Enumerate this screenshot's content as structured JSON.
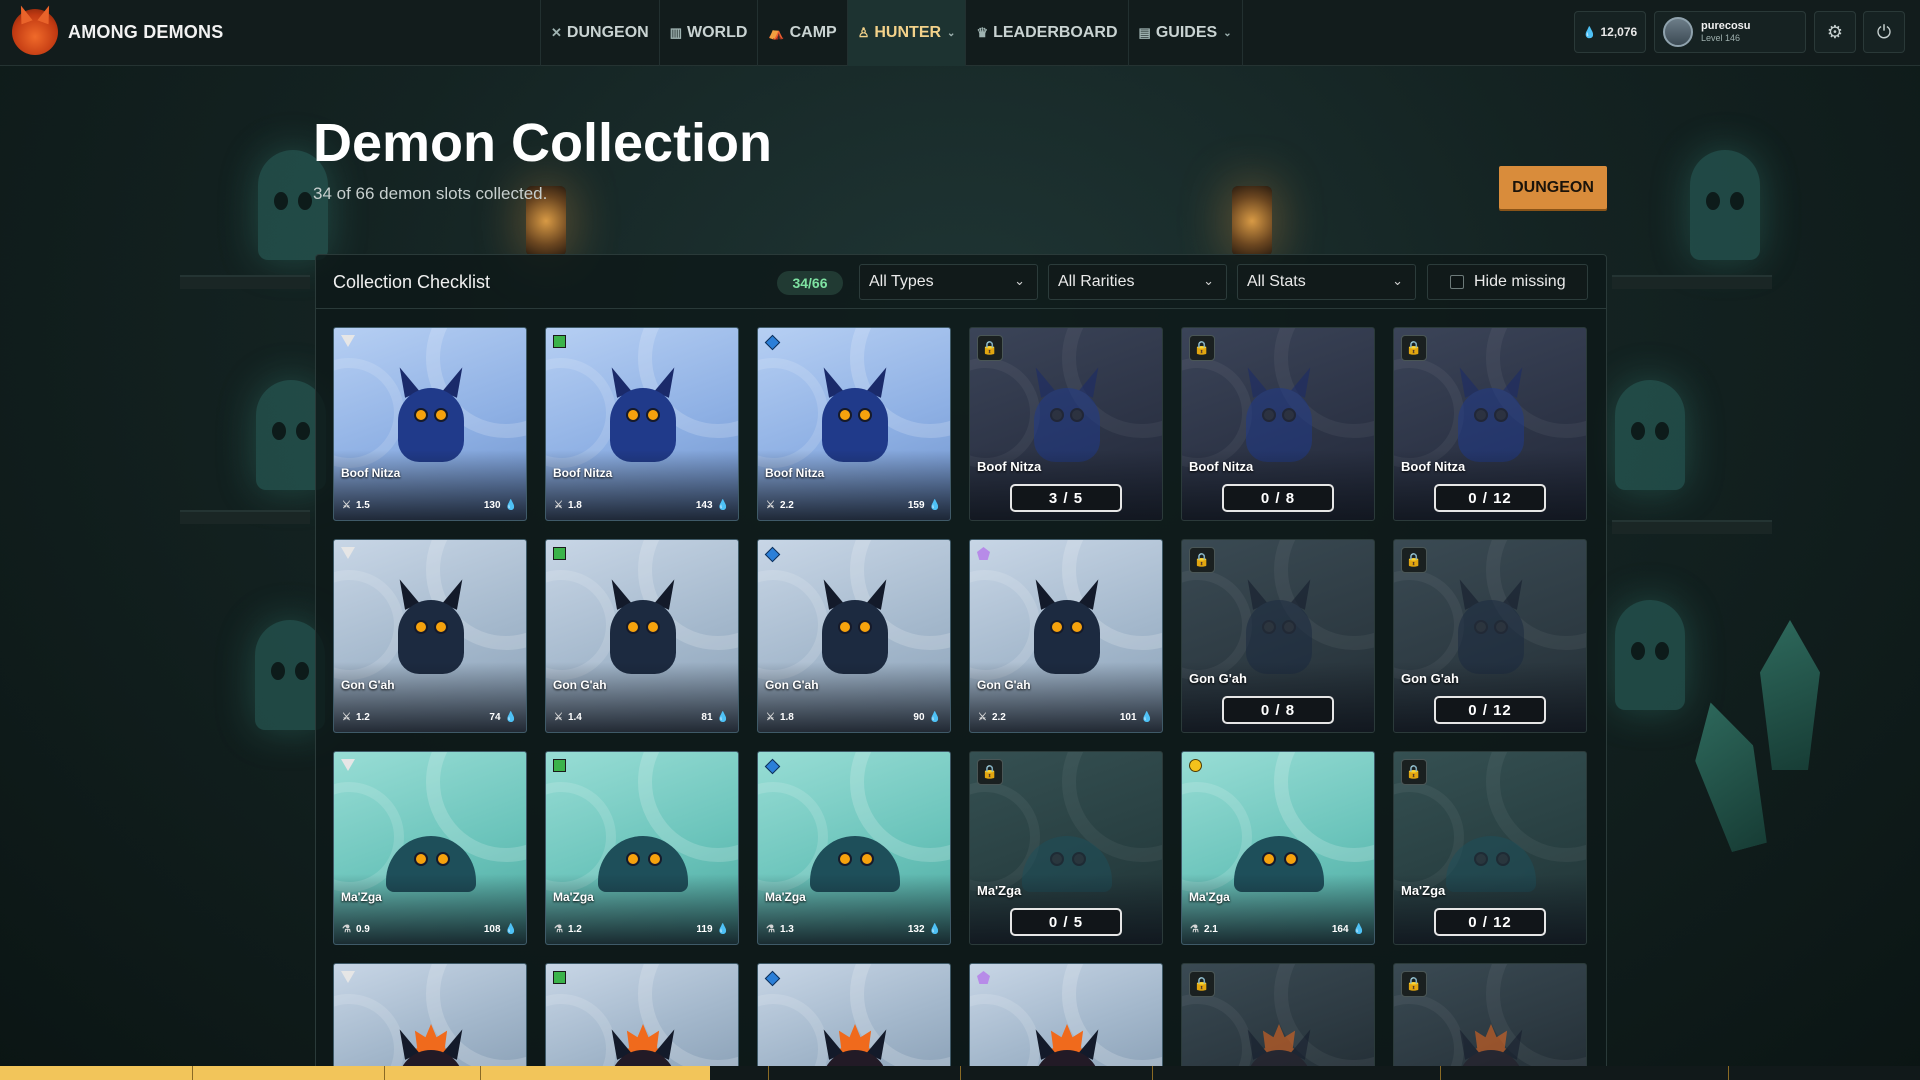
{
  "brand": {
    "name": "AMONG DEMONS"
  },
  "nav": [
    {
      "label": "DUNGEON",
      "icon": "crossed-swords-icon",
      "glyph": "✕",
      "active": false,
      "dropdown": false
    },
    {
      "label": "WORLD",
      "icon": "map-icon",
      "glyph": "▥",
      "active": false,
      "dropdown": false
    },
    {
      "label": "CAMP",
      "icon": "tent-icon",
      "glyph": "⛺",
      "active": false,
      "dropdown": false
    },
    {
      "label": "HUNTER",
      "icon": "person-icon",
      "glyph": "♙",
      "active": true,
      "dropdown": true
    },
    {
      "label": "LEADERBOARD",
      "icon": "trophy-icon",
      "glyph": "♛",
      "active": false,
      "dropdown": false
    },
    {
      "label": "GUIDES",
      "icon": "scroll-icon",
      "glyph": "▤",
      "active": false,
      "dropdown": true
    }
  ],
  "header_right": {
    "currency": "12,076",
    "username": "purecosu",
    "level": "Level 146"
  },
  "page": {
    "title": "Demon Collection",
    "subtitle": "34 of 66 demon slots collected.",
    "dungeon_button": "DUNGEON"
  },
  "panel": {
    "title": "Collection Checklist",
    "count": "34/66",
    "filters": {
      "types": "All Types",
      "rarities": "All Rarities",
      "stats": "All Stats",
      "hide_missing": "Hide missing"
    }
  },
  "colors": {
    "accent_gold": "#f3d28a",
    "dungeon_orange": "#d98c3b",
    "badge_green": "#7ee2a2",
    "common": "#e6e6e6",
    "uncommon": "#3bb34a",
    "rare": "#2b7fd8",
    "epic": "#b78be8",
    "legendary": "#f4c21b"
  },
  "cards": [
    [
      {
        "name": "Boof Nitza",
        "rarity": "common",
        "stat_icon": "crossed-swords-icon",
        "stat": "1.5",
        "value": "130",
        "bg": "blue",
        "kind": "beast"
      },
      {
        "name": "Boof Nitza",
        "rarity": "uncommon",
        "stat_icon": "crossed-swords-icon",
        "stat": "1.8",
        "value": "143",
        "bg": "blue",
        "kind": "beast"
      },
      {
        "name": "Boof Nitza",
        "rarity": "rare",
        "stat_icon": "crossed-swords-icon",
        "stat": "2.2",
        "value": "159",
        "bg": "blue",
        "kind": "beast"
      },
      {
        "name": "Boof Nitza",
        "locked": true,
        "progress": "3 / 5",
        "bg": "blue",
        "kind": "beast"
      },
      {
        "name": "Boof Nitza",
        "locked": true,
        "progress": "0 / 8",
        "bg": "blue",
        "kind": "beast"
      },
      {
        "name": "Boof Nitza",
        "locked": true,
        "progress": "0 / 12",
        "bg": "blue",
        "kind": "beast"
      }
    ],
    [
      {
        "name": "Gon G'ah",
        "rarity": "common",
        "stat_icon": "crossed-swords-icon",
        "stat": "1.2",
        "value": "74",
        "bg": "gray",
        "kind": "bug"
      },
      {
        "name": "Gon G'ah",
        "rarity": "uncommon",
        "stat_icon": "crossed-swords-icon",
        "stat": "1.4",
        "value": "81",
        "bg": "gray",
        "kind": "bug"
      },
      {
        "name": "Gon G'ah",
        "rarity": "rare",
        "stat_icon": "crossed-swords-icon",
        "stat": "1.8",
        "value": "90",
        "bg": "gray",
        "kind": "bug"
      },
      {
        "name": "Gon G'ah",
        "rarity": "epic",
        "stat_icon": "crossed-swords-icon",
        "stat": "2.2",
        "value": "101",
        "bg": "gray",
        "kind": "bug"
      },
      {
        "name": "Gon G'ah",
        "locked": true,
        "progress": "0 / 8",
        "bg": "gray",
        "kind": "bug"
      },
      {
        "name": "Gon G'ah",
        "locked": true,
        "progress": "0 / 12",
        "bg": "gray",
        "kind": "bug"
      }
    ],
    [
      {
        "name": "Ma'Zga",
        "rarity": "common",
        "stat_icon": "flask-icon",
        "stat": "0.9",
        "value": "108",
        "bg": "teal",
        "kind": "slime"
      },
      {
        "name": "Ma'Zga",
        "rarity": "uncommon",
        "stat_icon": "flask-icon",
        "stat": "1.2",
        "value": "119",
        "bg": "teal",
        "kind": "slime"
      },
      {
        "name": "Ma'Zga",
        "rarity": "rare",
        "stat_icon": "flask-icon",
        "stat": "1.3",
        "value": "132",
        "bg": "teal",
        "kind": "slime"
      },
      {
        "name": "Ma'Zga",
        "locked": true,
        "progress": "0 / 5",
        "bg": "teal",
        "kind": "slime"
      },
      {
        "name": "Ma'Zga",
        "rarity": "legendary",
        "stat_icon": "flask-icon",
        "stat": "2.1",
        "value": "164",
        "bg": "teal",
        "kind": "slime"
      },
      {
        "name": "Ma'Zga",
        "locked": true,
        "progress": "0 / 12",
        "bg": "teal",
        "kind": "slime"
      }
    ],
    [
      {
        "name": "",
        "rarity": "common",
        "bg": "gray",
        "kind": "fire",
        "partial": true
      },
      {
        "name": "",
        "rarity": "uncommon",
        "bg": "gray",
        "kind": "fire",
        "partial": true
      },
      {
        "name": "",
        "rarity": "rare",
        "bg": "gray",
        "kind": "fire",
        "partial": true
      },
      {
        "name": "",
        "rarity": "epic",
        "bg": "gray",
        "kind": "fire",
        "partial": true
      },
      {
        "name": "",
        "locked": true,
        "bg": "gray",
        "kind": "fire",
        "partial": true
      },
      {
        "name": "",
        "locked": true,
        "bg": "gray",
        "kind": "fire",
        "partial": true
      }
    ]
  ],
  "bottom_progress": 0.37
}
